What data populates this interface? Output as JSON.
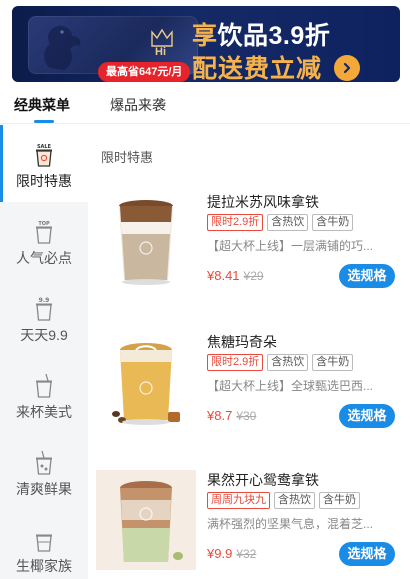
{
  "banner": {
    "hi_text": "Hi",
    "badge": "最高省647元/月",
    "line1_accent": "享",
    "line1_rest": "饮品3.9折",
    "line2": "配送费立减"
  },
  "tabs": [
    {
      "label": "经典菜单",
      "active": true
    },
    {
      "label": "爆品来袭",
      "active": false
    }
  ],
  "sidebar": {
    "items": [
      {
        "label": "限时特惠",
        "icon": "sale-cup-icon",
        "icon_text": "SALE",
        "active": true
      },
      {
        "label": "人气必点",
        "icon": "top-cup-icon",
        "icon_text": "TOP",
        "active": false
      },
      {
        "label": "天天9.9",
        "icon": "daily-99-cup-icon",
        "icon_text": "9.9",
        "active": false
      },
      {
        "label": "来杯美式",
        "icon": "americano-cup-icon",
        "active": false
      },
      {
        "label": "清爽鲜果",
        "icon": "fruit-drink-icon",
        "active": false
      },
      {
        "label": "生椰家族",
        "icon": "coconut-cup-icon",
        "active": false
      }
    ]
  },
  "section_title": "限时特惠",
  "products": [
    {
      "name": "提拉米苏风味拿铁",
      "tags": [
        "限时2.9折",
        "含热饮",
        "含牛奶"
      ],
      "desc": "【超大杯上线】一层满铺的巧...",
      "price": "¥8.41",
      "original_price": "¥29",
      "button": "选规格"
    },
    {
      "name": "焦糖玛奇朵",
      "tags": [
        "限时2.9折",
        "含热饮",
        "含牛奶"
      ],
      "desc": "【超大杯上线】全球甄选巴西...",
      "price": "¥8.7",
      "original_price": "¥30",
      "button": "选规格"
    },
    {
      "name": "果然开心鸳鸯拿铁",
      "tags": [
        "周周九块九",
        "含热饮",
        "含牛奶"
      ],
      "desc": "满杯强烈的坚果气息，混着芝...",
      "price": "¥9.9",
      "original_price": "¥32",
      "button": "选规格"
    }
  ],
  "colors": {
    "accent_blue": "#1a8ce6",
    "promo_red": "#e94a3b",
    "banner_gold": "#f6b24b",
    "banner_navy": "#142a66"
  }
}
